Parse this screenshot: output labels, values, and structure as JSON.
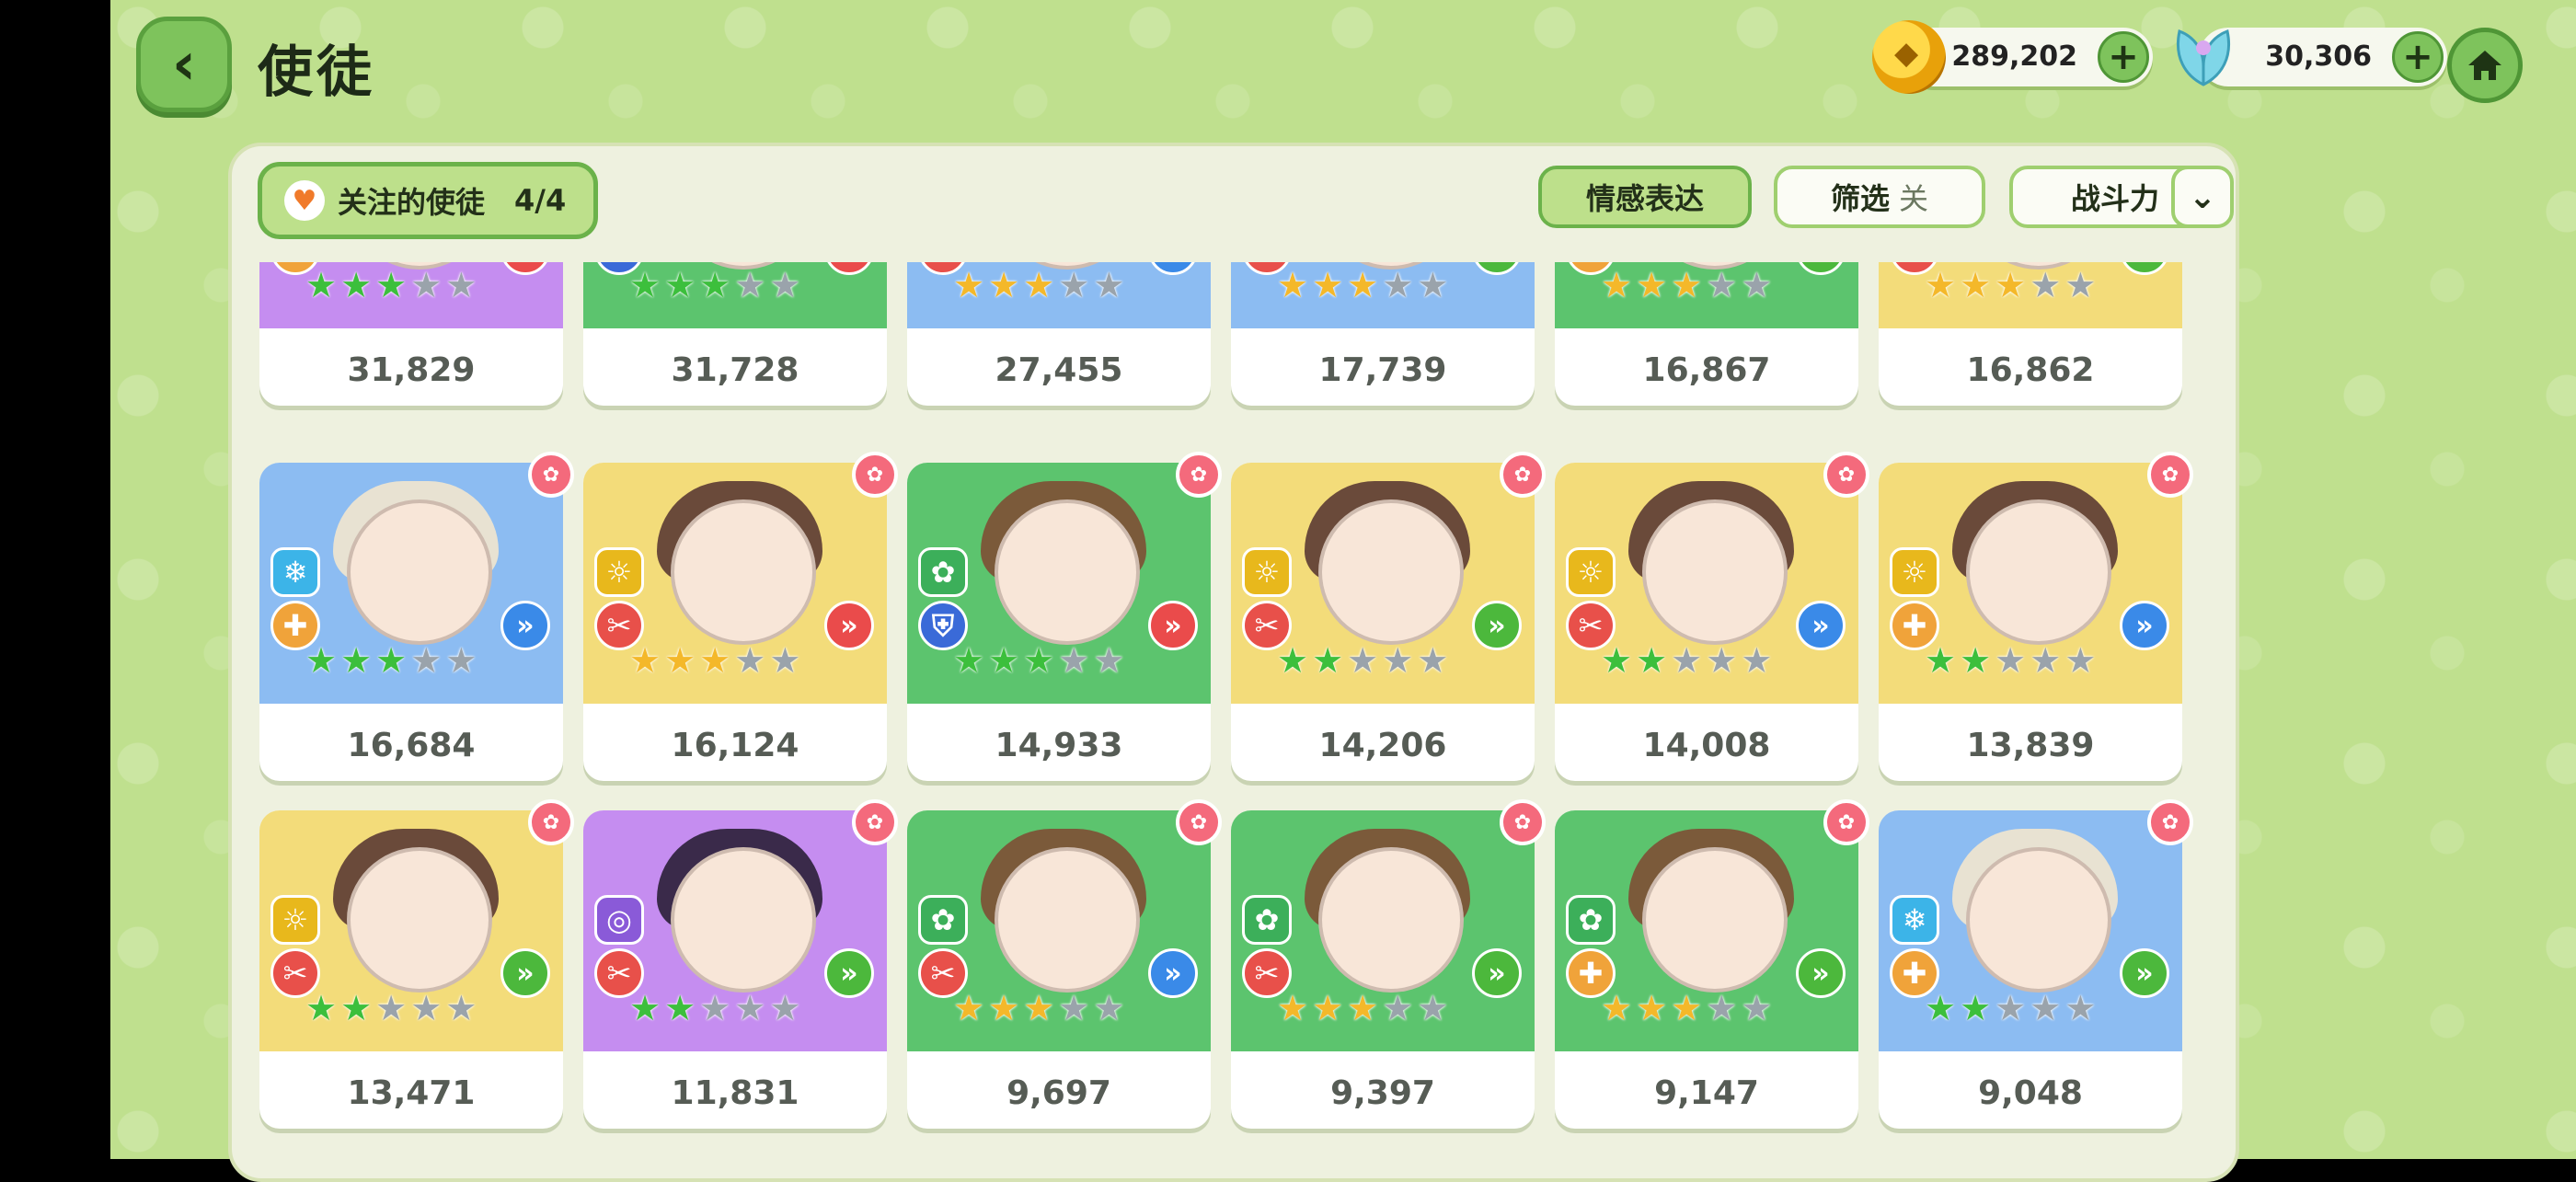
{
  "header": {
    "title": "使徒",
    "gold": "289,202",
    "gems": "30,306"
  },
  "toolbar": {
    "favorites_label": "关注的使徒",
    "favorites_count": "4/4",
    "emotion_label": "情感表达",
    "filter_label": "筛选",
    "filter_state": "关",
    "power_label": "战斗力"
  },
  "colors": {
    "bg": "#bfe08e",
    "purple": "#c58df0",
    "green": "#5cc46e",
    "blue": "#8cbcf2",
    "yellow": "#f3dc7a"
  },
  "cards": [
    {
      "power": "31,829",
      "bg": "purple",
      "stars": [
        "green",
        "green",
        "green",
        "grey",
        "grey"
      ],
      "element": null,
      "role": "heal",
      "type": "red"
    },
    {
      "power": "31,728",
      "bg": "green",
      "stars": [
        "green",
        "green",
        "green",
        "grey",
        "grey"
      ],
      "element": null,
      "role": "shield",
      "type": "red"
    },
    {
      "power": "27,455",
      "bg": "blue",
      "stars": [
        "gold",
        "gold",
        "gold",
        "grey",
        "grey"
      ],
      "element": null,
      "role": "attack",
      "type": "blue"
    },
    {
      "power": "17,739",
      "bg": "blue",
      "stars": [
        "gold",
        "gold",
        "gold",
        "grey",
        "grey"
      ],
      "element": null,
      "role": "attack",
      "type": "green"
    },
    {
      "power": "16,867",
      "bg": "green",
      "stars": [
        "gold",
        "gold",
        "gold",
        "grey",
        "grey"
      ],
      "element": null,
      "role": "heal",
      "type": "green"
    },
    {
      "power": "16,862",
      "bg": "yellow",
      "stars": [
        "gold",
        "gold",
        "gold",
        "grey",
        "grey"
      ],
      "element": null,
      "role": "attack",
      "type": "green"
    },
    {
      "power": "16,684",
      "bg": "blue",
      "stars": [
        "green",
        "green",
        "green",
        "grey",
        "grey"
      ],
      "element": "ice",
      "role": "heal",
      "type": "blue"
    },
    {
      "power": "16,124",
      "bg": "yellow",
      "stars": [
        "gold",
        "gold",
        "gold",
        "grey",
        "grey"
      ],
      "element": "light",
      "role": "attack",
      "type": "red"
    },
    {
      "power": "14,933",
      "bg": "green",
      "stars": [
        "green",
        "green",
        "green",
        "grey",
        "grey"
      ],
      "element": "nature",
      "role": "shield",
      "type": "red"
    },
    {
      "power": "14,206",
      "bg": "yellow",
      "stars": [
        "green",
        "green",
        "grey",
        "grey",
        "grey"
      ],
      "element": "light",
      "role": "attack",
      "type": "green"
    },
    {
      "power": "14,008",
      "bg": "yellow",
      "stars": [
        "green",
        "green",
        "grey",
        "grey",
        "grey"
      ],
      "element": "light",
      "role": "attack",
      "type": "blue"
    },
    {
      "power": "13,839",
      "bg": "yellow",
      "stars": [
        "green",
        "green",
        "grey",
        "grey",
        "grey"
      ],
      "element": "light",
      "role": "heal",
      "type": "blue"
    },
    {
      "power": "13,471",
      "bg": "yellow",
      "stars": [
        "green",
        "green",
        "grey",
        "grey",
        "grey"
      ],
      "element": "light",
      "role": "attack",
      "type": "green"
    },
    {
      "power": "11,831",
      "bg": "purple",
      "stars": [
        "green",
        "green",
        "grey",
        "grey",
        "grey"
      ],
      "element": "dark",
      "role": "attack",
      "type": "green"
    },
    {
      "power": "9,697",
      "bg": "green",
      "stars": [
        "gold",
        "gold",
        "gold",
        "grey",
        "grey"
      ],
      "element": "nature",
      "role": "attack",
      "type": "blue"
    },
    {
      "power": "9,397",
      "bg": "green",
      "stars": [
        "gold",
        "gold",
        "gold",
        "grey",
        "grey"
      ],
      "element": "nature",
      "role": "attack",
      "type": "green"
    },
    {
      "power": "9,147",
      "bg": "green",
      "stars": [
        "gold",
        "gold",
        "gold",
        "grey",
        "grey"
      ],
      "element": "nature",
      "role": "heal",
      "type": "green"
    },
    {
      "power": "9,048",
      "bg": "blue",
      "stars": [
        "green",
        "green",
        "grey",
        "grey",
        "grey"
      ],
      "element": "ice",
      "role": "heal",
      "type": "green"
    }
  ]
}
